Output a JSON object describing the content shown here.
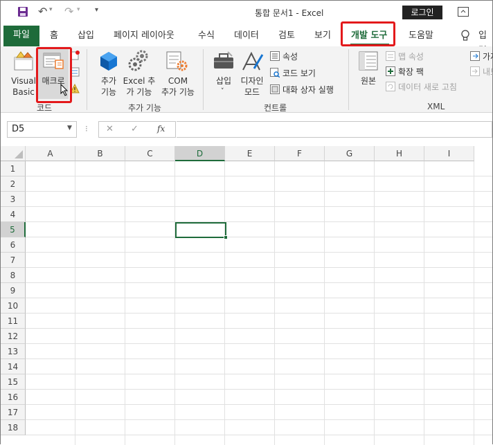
{
  "titlebar": {
    "title": "통합 문서1  -  Excel",
    "login": "로그인",
    "undo": "↶",
    "redo": "↷",
    "qat_more": "▾"
  },
  "tabs": {
    "file": "파일",
    "home": "홈",
    "insert": "삽입",
    "page_layout": "페이지 레이아웃",
    "formulas": "수식",
    "data": "데이터",
    "review": "검토",
    "view": "보기",
    "developer": "개발 도구",
    "help": "도움말",
    "tell_me": "입력"
  },
  "ribbon": {
    "code": {
      "visual_basic": [
        "Visual",
        "Basic"
      ],
      "macro": "매크로",
      "group": "코드"
    },
    "addins": {
      "addin": [
        "추가",
        "기능"
      ],
      "excel_addin": [
        "Excel 추",
        "가 기능"
      ],
      "com_addin": [
        "COM",
        "추가 기능"
      ],
      "group": "추가 기능"
    },
    "controls": {
      "insert": "삽입",
      "design_mode": [
        "디자인",
        "모드"
      ],
      "properties": "속성",
      "view_code": "코드 보기",
      "run_dialog": "대화 상자 실행",
      "group": "컨트롤"
    },
    "xml": {
      "source": "원본",
      "map_properties": "맵 속성",
      "expansion_pack": "확장 팩",
      "refresh_data": "데이터 새로 고침",
      "import": "가져",
      "export": "내보",
      "group": "XML"
    }
  },
  "formula_bar": {
    "name_box": "D5",
    "cancel": "✕",
    "enter": "✓",
    "fx": "fx",
    "value": ""
  },
  "grid": {
    "columns": [
      "A",
      "B",
      "C",
      "D",
      "E",
      "F",
      "G",
      "H",
      "I"
    ],
    "rows": [
      "1",
      "2",
      "3",
      "4",
      "5",
      "6",
      "7",
      "8",
      "9",
      "10",
      "11",
      "12",
      "13",
      "14",
      "15",
      "16",
      "17",
      "18"
    ],
    "selected_cell": "D5",
    "selected_col": "D",
    "selected_row": "5"
  },
  "colors": {
    "excel_green": "#1e6b3a",
    "highlight_red": "#e3191b"
  }
}
